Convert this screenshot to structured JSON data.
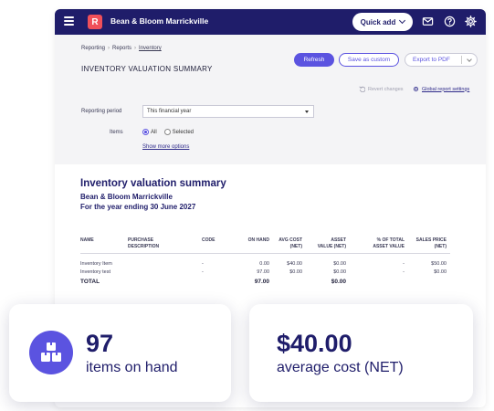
{
  "header": {
    "logo_letter": "R",
    "org_name": "Bean & Bloom Marrickville",
    "quick_add_label": "Quick add"
  },
  "breadcrumb": {
    "items": [
      "Reporting",
      "Reports",
      "Inventory"
    ]
  },
  "panel": {
    "title": "INVENTORY VALUATION SUMMARY",
    "refresh_label": "Refresh",
    "save_custom_label": "Save as custom",
    "export_label": "Export to PDF",
    "revert_label": "Revert changes",
    "global_settings_label": "Global report settings",
    "reporting_period_label": "Reporting period",
    "reporting_period_value": "This financial year",
    "items_label": "Items",
    "items_options": [
      "All",
      "Selected"
    ],
    "items_selected": "All",
    "show_more_label": "Show more options"
  },
  "report": {
    "title": "Inventory valuation summary",
    "org": "Bean & Bloom Marrickville",
    "period": "For the year ending 30 June 2027",
    "columns": [
      [
        "NAME"
      ],
      [
        "PURCHASE",
        "DESCRIPTION"
      ],
      [
        "CODE"
      ],
      [
        "ON HAND"
      ],
      [
        "AVG COST",
        "(NET)"
      ],
      [
        "ASSET",
        "VALUE (NET)"
      ],
      [
        "% OF TOTAL",
        "ASSET VALUE"
      ],
      [
        "SALES PRICE",
        "(NET)"
      ]
    ],
    "rows": [
      {
        "name": "Inventory Item",
        "code": "-",
        "on_hand": "0.00",
        "avg_cost": "$40.00",
        "asset_value": "$0.00",
        "pct": "-",
        "sales_price": "$50.00"
      },
      {
        "name": "Inventory test",
        "code": "-",
        "on_hand": "97.00",
        "avg_cost": "$0.00",
        "asset_value": "$0.00",
        "pct": "-",
        "sales_price": "$0.00"
      }
    ],
    "total": {
      "label": "TOTAL",
      "on_hand": "97.00",
      "asset_value": "$0.00"
    }
  },
  "cards": {
    "items_on_hand": {
      "value": "97",
      "label": "items on hand",
      "icon": "boxes-icon"
    },
    "average_cost": {
      "value": "$40.00",
      "label": "average cost (NET)"
    }
  },
  "colors": {
    "nav": "#1f1d6a",
    "accent": "#5b53e0",
    "brand_logo": "#f0505a"
  }
}
